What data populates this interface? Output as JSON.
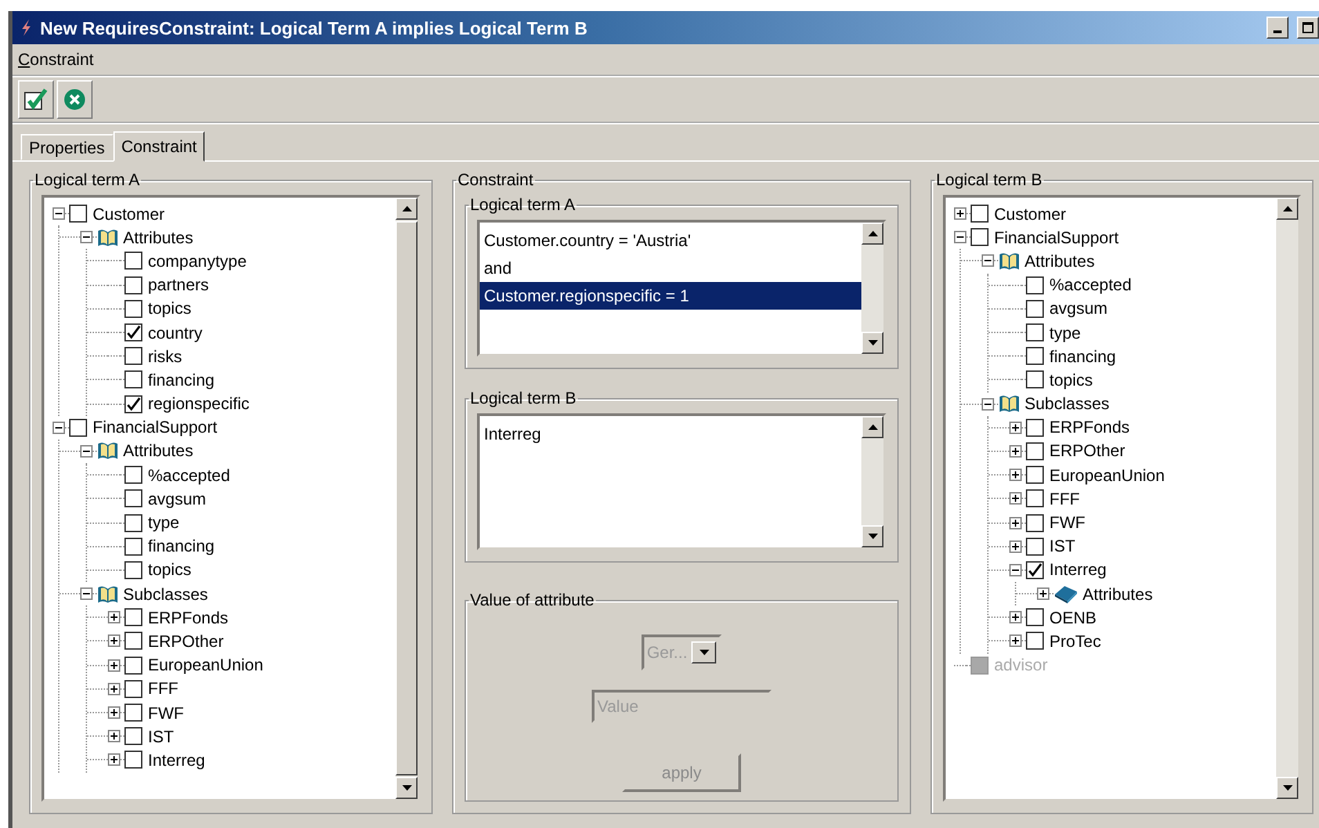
{
  "window": {
    "title": "New RequiresConstraint: Logical Term A implies Logical Term B"
  },
  "menu": [
    {
      "label": "Constraint"
    }
  ],
  "toolbar": [
    {
      "kind": "apply"
    },
    {
      "kind": "cancel"
    }
  ],
  "tabs": [
    {
      "label": "Properties",
      "selected": false
    },
    {
      "label": "Constraint",
      "selected": true
    }
  ],
  "left": {
    "title": "Logical term A",
    "tree": [
      {
        "label": "Customer",
        "kind": "class",
        "checked": false,
        "expanded": true,
        "children": [
          {
            "label": "Attributes",
            "kind": "folder",
            "expanded": true,
            "children": [
              {
                "label": "companytype",
                "kind": "attribute",
                "checked": false
              },
              {
                "label": "partners",
                "kind": "attribute",
                "checked": false
              },
              {
                "label": "topics",
                "kind": "attribute",
                "checked": false
              },
              {
                "label": "country",
                "kind": "attribute",
                "checked": true
              },
              {
                "label": "risks",
                "kind": "attribute",
                "checked": false
              },
              {
                "label": "financing",
                "kind": "attribute",
                "checked": false
              },
              {
                "label": "regionspecific",
                "kind": "attribute",
                "checked": true
              }
            ]
          }
        ]
      },
      {
        "label": "FinancialSupport",
        "kind": "class",
        "checked": false,
        "expanded": true,
        "children": [
          {
            "label": "Attributes",
            "kind": "folder",
            "expanded": true,
            "children": [
              {
                "label": "%accepted",
                "kind": "attribute",
                "checked": false
              },
              {
                "label": "avgsum",
                "kind": "attribute",
                "checked": false
              },
              {
                "label": "type",
                "kind": "attribute",
                "checked": false
              },
              {
                "label": "financing",
                "kind": "attribute",
                "checked": false
              },
              {
                "label": "topics",
                "kind": "attribute",
                "checked": false
              }
            ]
          },
          {
            "label": "Subclasses",
            "kind": "folder",
            "expanded": true,
            "children": [
              {
                "label": "ERPFonds",
                "kind": "class",
                "checked": false,
                "expanded": false
              },
              {
                "label": "ERPOther",
                "kind": "class",
                "checked": false,
                "expanded": false
              },
              {
                "label": "EuropeanUnion",
                "kind": "class",
                "checked": false,
                "expanded": false
              },
              {
                "label": "FFF",
                "kind": "class",
                "checked": false,
                "expanded": false
              },
              {
                "label": "FWF",
                "kind": "class",
                "checked": false,
                "expanded": false
              },
              {
                "label": "IST",
                "kind": "class",
                "checked": false,
                "expanded": false
              },
              {
                "label": "Interreg",
                "kind": "class",
                "checked": false,
                "expanded": false
              }
            ]
          }
        ]
      }
    ]
  },
  "center": {
    "title": "Constraint",
    "term_a": {
      "title": "Logical term A",
      "lines": [
        {
          "text": "Customer.country = 'Austria'",
          "selected": false
        },
        {
          "text": "and",
          "selected": false
        },
        {
          "text": "Customer.regionspecific = 1",
          "selected": true
        }
      ]
    },
    "term_b": {
      "title": "Logical term B",
      "lines": [
        {
          "text": "Interreg",
          "selected": false
        }
      ]
    },
    "value_group": {
      "title": "Value of attribute",
      "combo": {
        "value": "Ger...",
        "disabled": true
      },
      "field": {
        "placeholder": "Value",
        "disabled": true
      },
      "button": {
        "label": "apply",
        "disabled": true
      }
    }
  },
  "right": {
    "title": "Logical term B",
    "tree": [
      {
        "label": "Customer",
        "kind": "class",
        "checked": false,
        "expanded": false
      },
      {
        "label": "FinancialSupport",
        "kind": "class",
        "checked": false,
        "expanded": true,
        "children": [
          {
            "label": "Attributes",
            "kind": "folder",
            "expanded": true,
            "children": [
              {
                "label": "%accepted",
                "kind": "attribute",
                "checked": false
              },
              {
                "label": "avgsum",
                "kind": "attribute",
                "checked": false
              },
              {
                "label": "type",
                "kind": "attribute",
                "checked": false
              },
              {
                "label": "financing",
                "kind": "attribute",
                "checked": false
              },
              {
                "label": "topics",
                "kind": "attribute",
                "checked": false
              }
            ]
          },
          {
            "label": "Subclasses",
            "kind": "folder",
            "expanded": true,
            "children": [
              {
                "label": "ERPFonds",
                "kind": "class",
                "checked": false,
                "expanded": false
              },
              {
                "label": "ERPOther",
                "kind": "class",
                "checked": false,
                "expanded": false
              },
              {
                "label": "EuropeanUnion",
                "kind": "class",
                "checked": false,
                "expanded": false
              },
              {
                "label": "FFF",
                "kind": "class",
                "checked": false,
                "expanded": false
              },
              {
                "label": "FWF",
                "kind": "class",
                "checked": false,
                "expanded": false
              },
              {
                "label": "IST",
                "kind": "class",
                "checked": false,
                "expanded": false
              },
              {
                "label": "Interreg",
                "kind": "class",
                "checked": true,
                "expanded": true,
                "children": [
                  {
                    "label": "Attributes",
                    "kind": "folder",
                    "expanded": false
                  }
                ]
              },
              {
                "label": "OENB",
                "kind": "class",
                "checked": false,
                "expanded": false
              },
              {
                "label": "ProTec",
                "kind": "class",
                "checked": false,
                "expanded": false
              }
            ]
          }
        ]
      },
      {
        "label": "advisor",
        "kind": "attribute",
        "checked": false,
        "disabled": true
      }
    ]
  }
}
